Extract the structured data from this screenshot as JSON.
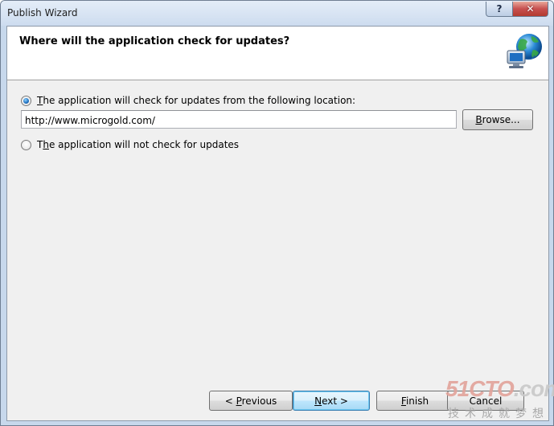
{
  "window": {
    "title": "Publish Wizard",
    "help_glyph": "?",
    "close_glyph": "✕"
  },
  "header": {
    "title": "Where will the application check for updates?",
    "icon": "globe-network-icon"
  },
  "options": {
    "check_updates": {
      "access_key": "T",
      "label_rest": "he application will check for updates from the following location:",
      "selected": true
    },
    "no_updates": {
      "pre": "T",
      "access_key": "h",
      "label_rest": "e application will not check for updates",
      "selected": false
    }
  },
  "location": {
    "value": "http://www.microgold.com/"
  },
  "browse_button": {
    "access_key": "B",
    "label_rest": "rowse..."
  },
  "footer": {
    "previous": {
      "pre": "< ",
      "access_key": "P",
      "label_rest": "revious"
    },
    "next": {
      "access_key": "N",
      "label_rest": "ext >"
    },
    "finish": {
      "access_key": "F",
      "label_rest": "inish"
    },
    "cancel": {
      "label": "Cancel"
    }
  },
  "watermark": {
    "brand_red": "51CTO",
    "brand_rest": ".com",
    "tagline": "技术成就梦想"
  }
}
